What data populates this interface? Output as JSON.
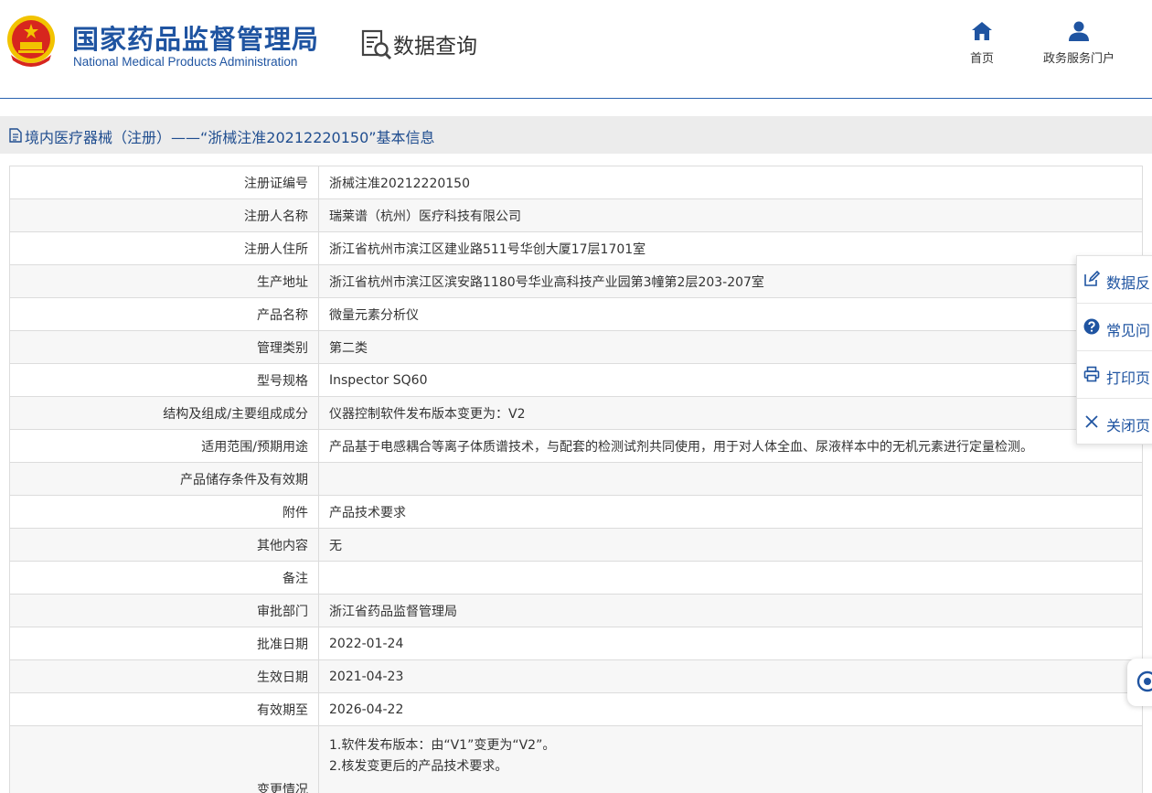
{
  "header": {
    "org_name_cn": "国家药品监督管理局",
    "org_name_en": "National Medical Products Administration",
    "section": "数据查询",
    "nav": [
      {
        "label": "首页",
        "icon": "home-icon"
      },
      {
        "label": "政务服务门户",
        "icon": "user-icon"
      }
    ]
  },
  "page_title": "境内医疗器械（注册）——“浙械注准20212220150”基本信息",
  "rows": [
    {
      "label": "注册证编号",
      "value": "浙械注准20212220150"
    },
    {
      "label": "注册人名称",
      "value": "瑞莱谱（杭州）医疗科技有限公司"
    },
    {
      "label": "注册人住所",
      "value": "浙江省杭州市滨江区建业路511号华创大厦17层1701室"
    },
    {
      "label": "生产地址",
      "value": "浙江省杭州市滨江区滨安路1180号华业高科技产业园第3幢第2层203-207室"
    },
    {
      "label": "产品名称",
      "value": "微量元素分析仪"
    },
    {
      "label": "管理类别",
      "value": "第二类"
    },
    {
      "label": "型号规格",
      "value": "Inspector SQ60"
    },
    {
      "label": "结构及组成/主要组成成分",
      "value": "仪器控制软件发布版本变更为：V2"
    },
    {
      "label": "适用范围/预期用途",
      "value": "产品基于电感耦合等离子体质谱技术，与配套的检测试剂共同使用，用于对人体全血、尿液样本中的无机元素进行定量检测。"
    },
    {
      "label": "产品储存条件及有效期",
      "value": ""
    },
    {
      "label": "附件",
      "value": "产品技术要求"
    },
    {
      "label": "其他内容",
      "value": "无"
    },
    {
      "label": "备注",
      "value": ""
    },
    {
      "label": "审批部门",
      "value": "浙江省药品监督管理局"
    },
    {
      "label": "批准日期",
      "value": "2022-01-24"
    },
    {
      "label": "生效日期",
      "value": "2021-04-23"
    },
    {
      "label": "有效期至",
      "value": "2026-04-22"
    }
  ],
  "change": {
    "label": "变更情况",
    "lines": [
      "1.软件发布版本：由“V1”变更为“V2”。",
      "2.核发变更后的产品技术要求。"
    ]
  },
  "float_panel": [
    {
      "label": "数据反",
      "icon": "edit-icon"
    },
    {
      "label": "常见问",
      "icon": "question-icon"
    },
    {
      "label": "打印页",
      "icon": "print-icon"
    },
    {
      "label": "关闭页",
      "icon": "close-icon"
    }
  ],
  "colors": {
    "brand": "#1f54a1",
    "title": "#1f4d8f",
    "emblem_red": "#d7261e",
    "emblem_gold": "#f2c300"
  }
}
